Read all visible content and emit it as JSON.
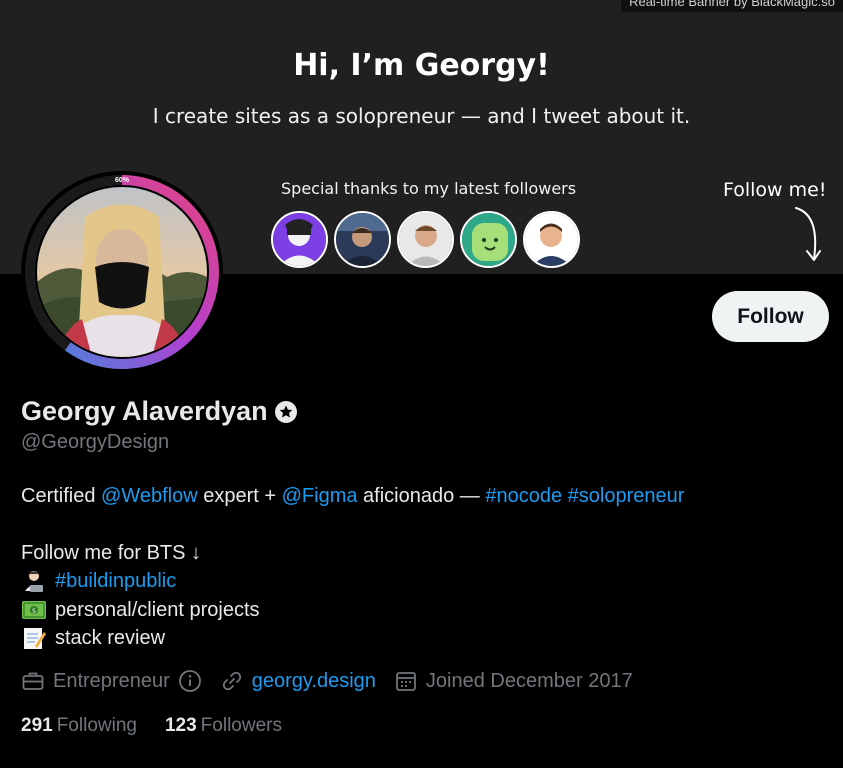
{
  "banner": {
    "credit": "Real-time Banner by BlackMagic.so",
    "heading": "Hi, I’m Georgy!",
    "subheading": "I create sites as a solopreneur — and I tweet about it.",
    "thanks_label": "Special thanks to my latest followers",
    "follow_me_label": "Follow me!",
    "ring_percent": "60%",
    "ring_progress": 0.6
  },
  "profile": {
    "name": "Georgy Alaverdyan",
    "handle": "@GeorgyDesign",
    "follow_button": "Follow"
  },
  "bio": {
    "line1_prefix": "Certified ",
    "line1_link1": "@Webflow",
    "line1_mid1": " expert + ",
    "line1_link2": "@Figma",
    "line1_mid2": " aficionado — ",
    "line1_tag1": "#nocode",
    "line1_space": " ",
    "line1_tag2": "#solopreneur",
    "line2": "Follow me for BTS ↓",
    "line3_tag": "#buildinpublic",
    "line4": "personal/client projects",
    "line5": "stack review"
  },
  "meta": {
    "category": "Entrepreneur",
    "website": "georgy.design",
    "joined": "Joined December 2017"
  },
  "stats": {
    "following_count": "291",
    "following_label": "Following",
    "followers_count": "123",
    "followers_label": "Followers"
  },
  "icons": {
    "verified": "verified-star-icon",
    "category": "briefcase-icon",
    "info": "info-icon",
    "website": "link-icon",
    "joined": "calendar-icon"
  },
  "colors": {
    "accent_link": "#1d9bf0",
    "muted": "#71767b",
    "ring_start": "#3a8fe0",
    "ring_mid": "#b23fd0",
    "ring_end": "#e6457d"
  }
}
